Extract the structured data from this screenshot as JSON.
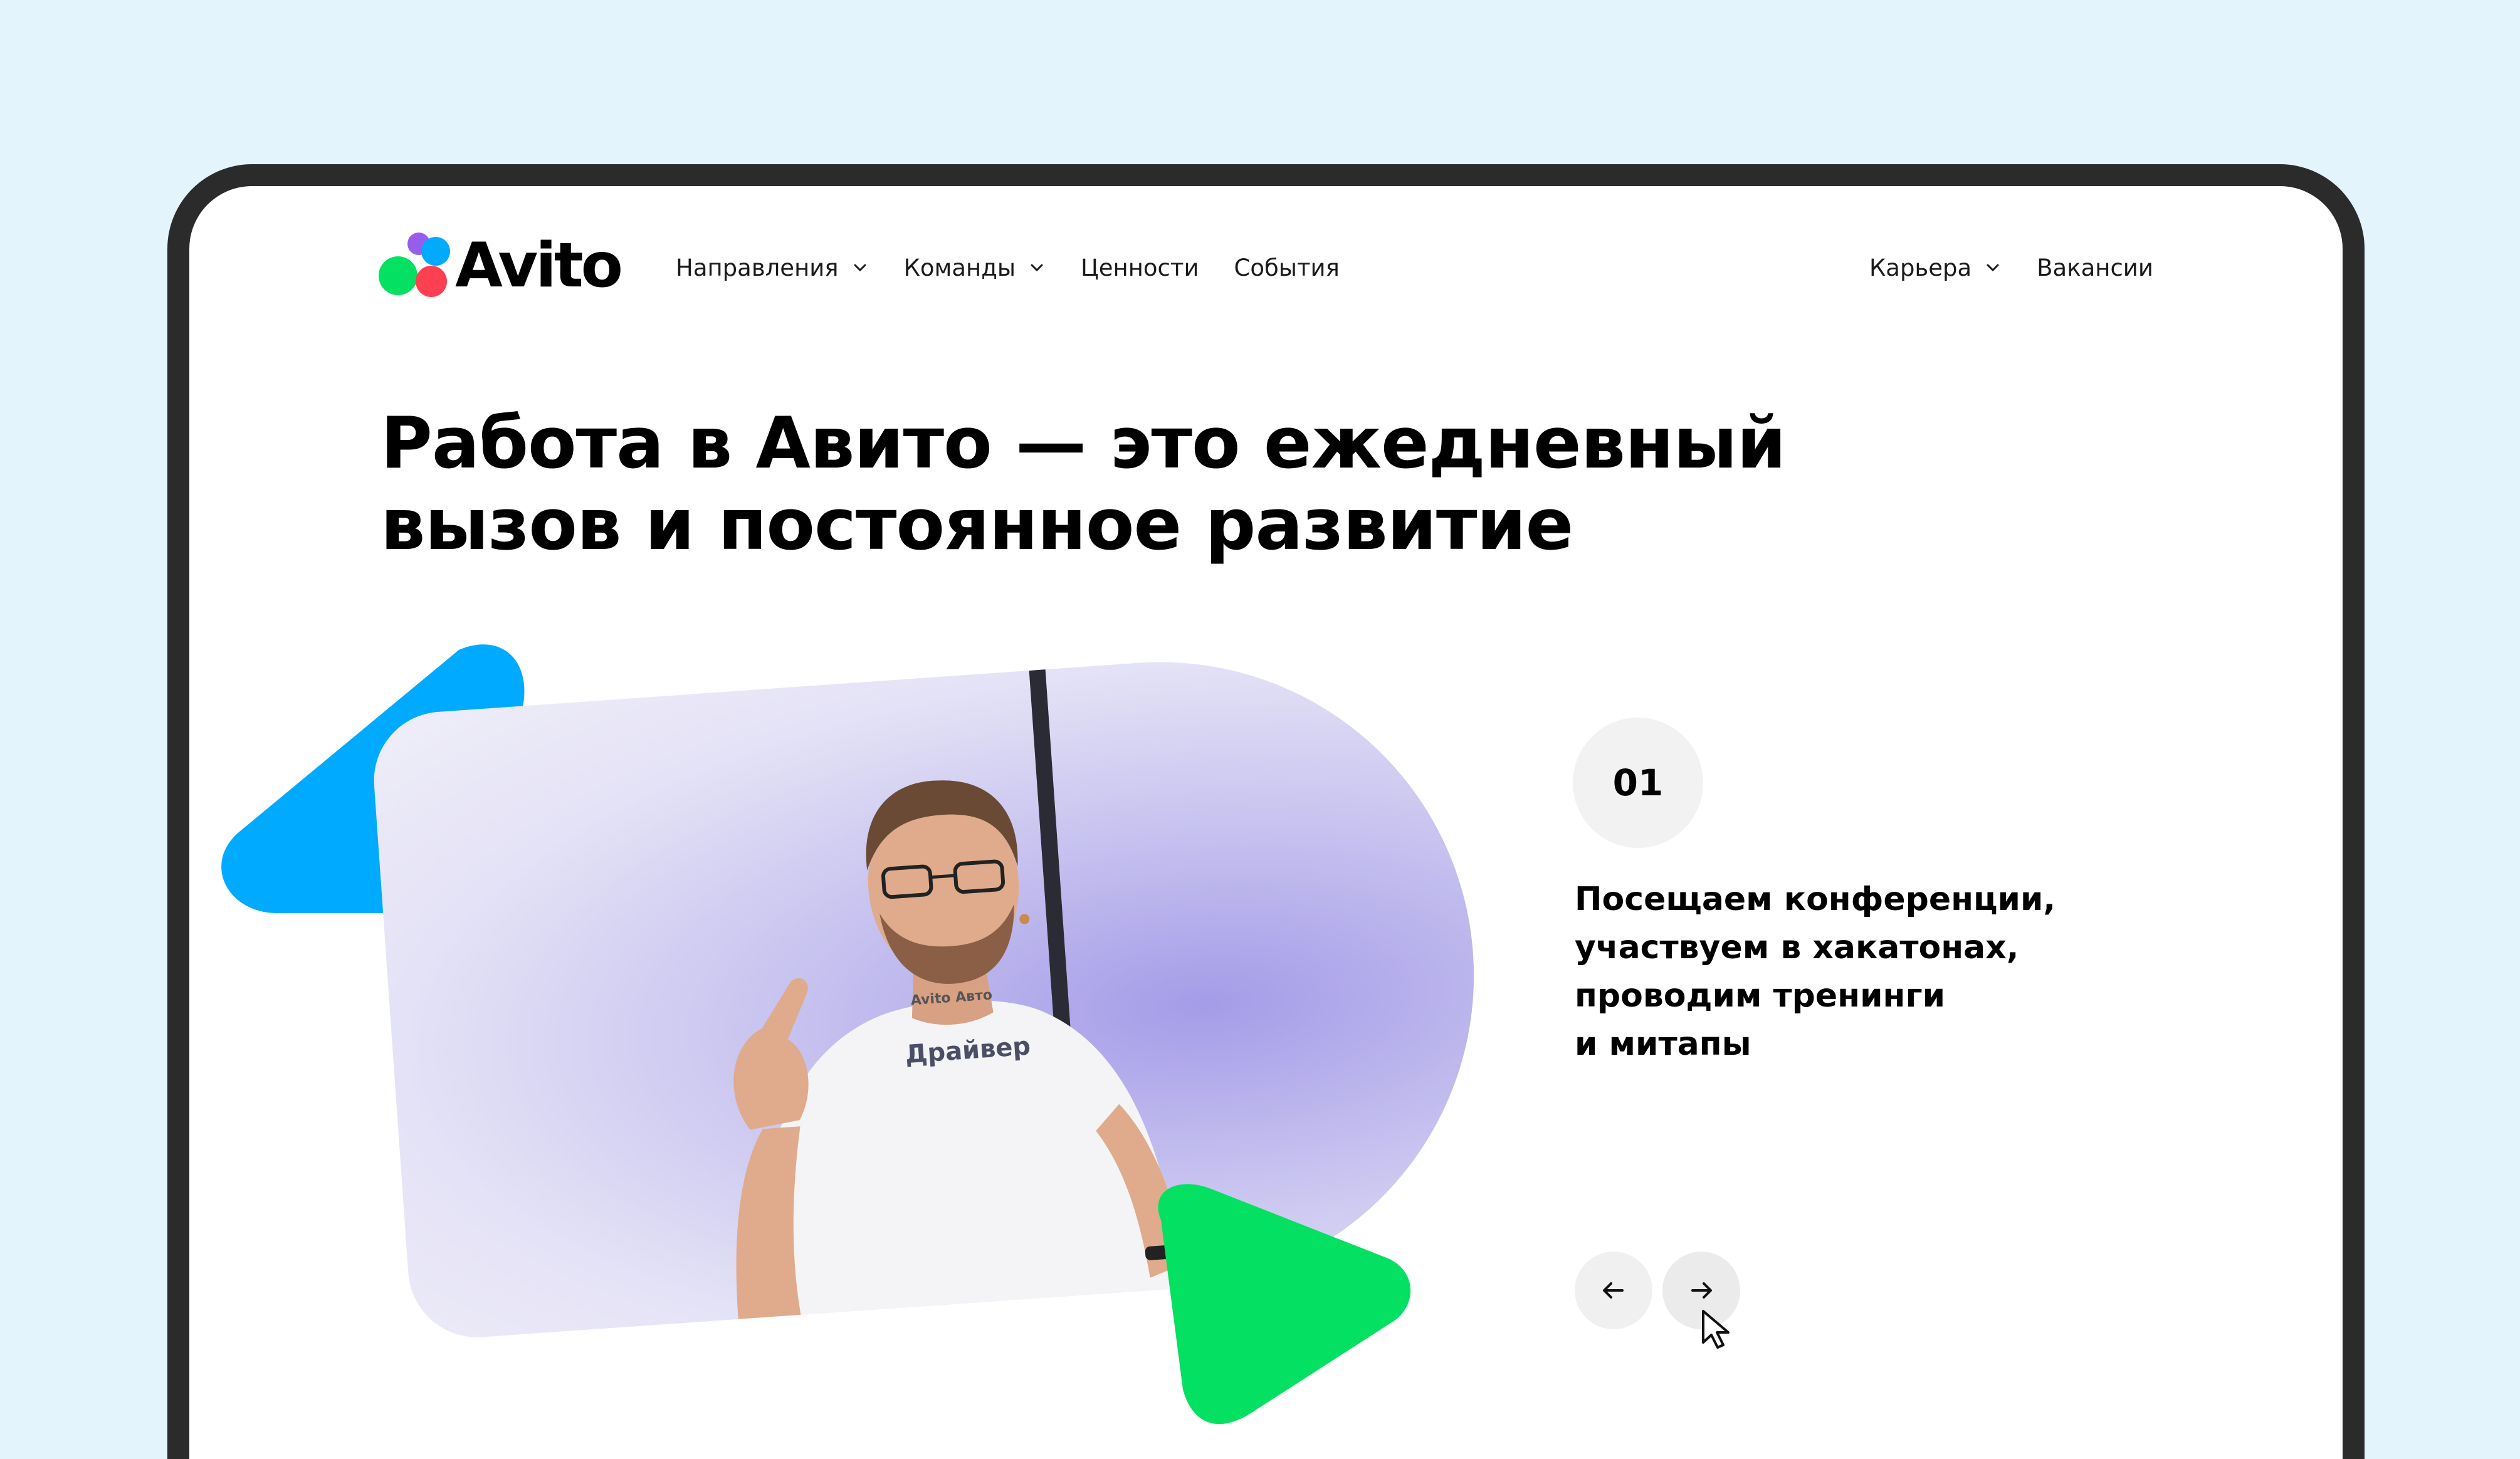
{
  "brand": {
    "name": "Avito",
    "colors": {
      "green": "#04e061",
      "red": "#ff4053",
      "purple": "#965eeb",
      "blue": "#00aaff"
    }
  },
  "nav": {
    "left": [
      {
        "label": "Направления",
        "has_dropdown": true,
        "icon": "chevron-down-icon"
      },
      {
        "label": "Команды",
        "has_dropdown": true,
        "icon": "chevron-down-icon"
      },
      {
        "label": "Ценности",
        "has_dropdown": false
      },
      {
        "label": "События",
        "has_dropdown": false
      }
    ],
    "right": [
      {
        "label": "Карьера",
        "has_dropdown": true,
        "icon": "chevron-down-icon"
      },
      {
        "label": "Вакансии",
        "has_dropdown": false
      }
    ]
  },
  "hero": {
    "headline_line1": "Работа в Авито — это ежедневный",
    "headline_line2": "вызов и постоянное развитие"
  },
  "photo": {
    "shirt_brand": "Avito Авто",
    "shirt_label": "Драйвер"
  },
  "slide": {
    "number": "01",
    "text_lines": [
      "Посещаем конференции,",
      "участвуем в хакатонах,",
      "проводим тренинги",
      "и митапы"
    ],
    "prev_icon": "arrow-left-icon",
    "next_icon": "arrow-right-icon"
  }
}
